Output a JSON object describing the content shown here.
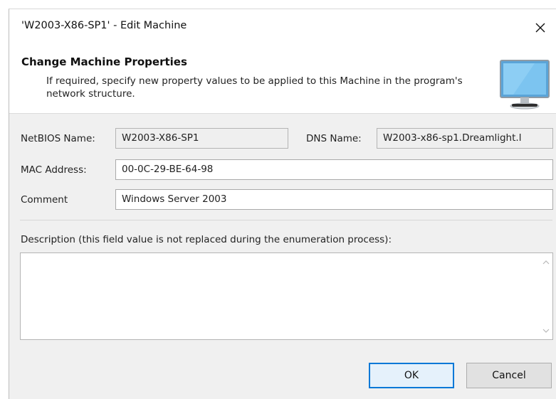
{
  "window": {
    "title": "'W2003-X86-SP1' - Edit Machine"
  },
  "header": {
    "title": "Change Machine Properties",
    "description": "If required, specify new property values to be applied to this Machine in the program's network structure."
  },
  "form": {
    "netbios_label": "NetBIOS Name:",
    "netbios_value": "W2003-X86-SP1",
    "dns_label": "DNS Name:",
    "dns_value": "W2003-x86-sp1.Dreamlight.l",
    "mac_label": "MAC Address:",
    "mac_value": "00-0C-29-BE-64-98",
    "comment_label": "Comment",
    "comment_value": "Windows Server 2003",
    "description_label": "Description (this field value is not replaced during the enumeration process):",
    "description_value": ""
  },
  "buttons": {
    "ok": "OK",
    "cancel": "Cancel"
  },
  "icons": {
    "close": "close-icon",
    "monitor": "monitor-icon",
    "scroll_up": "chevron-up-icon",
    "scroll_down": "chevron-down-icon"
  },
  "colors": {
    "accent": "#0078d7",
    "dialog_bg": "#f0f0f0"
  }
}
